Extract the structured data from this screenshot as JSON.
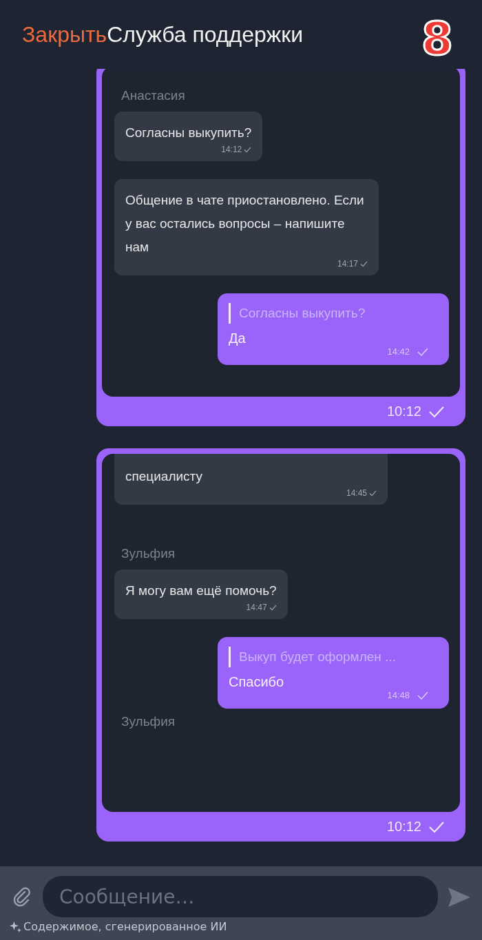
{
  "header": {
    "close": "Закрыть",
    "title": "Служба поддержки"
  },
  "overlay_number": "8",
  "messages": [
    {
      "time": "10:12",
      "items": [
        {
          "kind": "sender",
          "text": "Анастасия"
        },
        {
          "kind": "incoming",
          "text": "Согласны выкупить?",
          "time": "14:12"
        },
        {
          "kind": "incoming",
          "text": "Общение в чате приостановлено. Если у вас остались вопросы – напишите нам",
          "time": "14:17"
        },
        {
          "kind": "outgoing",
          "quote": "Согласны выкупить?",
          "text": "Да",
          "time": "14:42"
        }
      ]
    },
    {
      "time": "10:12",
      "items": [
        {
          "kind": "incoming_cut",
          "text": "специалисту",
          "time": "14:45"
        },
        {
          "kind": "sender",
          "text": "Зульфия"
        },
        {
          "kind": "incoming",
          "text": "Я могу вам ещё помочь?",
          "time": "14:47"
        },
        {
          "kind": "outgoing",
          "quote": "Выкуп будет оформлен ...",
          "text": "Спасибо",
          "time": "14:48"
        },
        {
          "kind": "sender",
          "text": "Зульфия"
        }
      ]
    }
  ],
  "composer": {
    "placeholder": "Сообщение…",
    "ai_note": "Содержимое, сгенерированное ИИ"
  }
}
